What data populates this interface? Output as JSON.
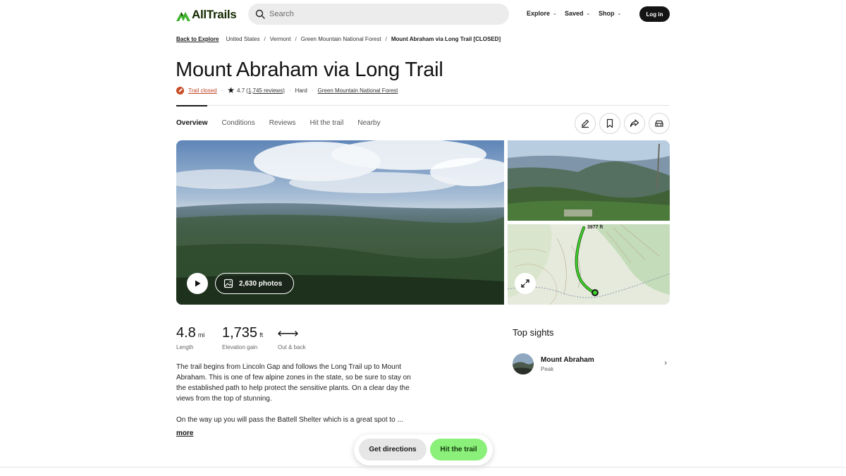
{
  "brand": {
    "name": "AllTrails",
    "accent": "#8bf07a"
  },
  "search": {
    "placeholder": "Search"
  },
  "nav": {
    "explore": "Explore",
    "saved": "Saved",
    "shop": "Shop",
    "login": "Log in"
  },
  "breadcrumb": {
    "back": "Back to Explore",
    "items": [
      "United States",
      "Vermont",
      "Green Mountain National Forest"
    ],
    "current": "Mount Abraham via Long Trail [CLOSED]"
  },
  "trail": {
    "title": "Mount Abraham via Long Trail",
    "status": "Trail closed",
    "rating": "4.7",
    "reviews": "(1,745 reviews)",
    "difficulty": "Hard",
    "forest": "Green Mountain National Forest"
  },
  "tabs": [
    "Overview",
    "Conditions",
    "Reviews",
    "Hit the trail",
    "Nearby"
  ],
  "actions": [
    "edit-icon",
    "bookmark-icon",
    "share-icon",
    "car-icon"
  ],
  "photos": {
    "count_label": "2,630 photos",
    "map_elevation": "3977 ft"
  },
  "stats": {
    "length": {
      "value": "4.8",
      "unit": "mi",
      "label": "Length"
    },
    "elevation": {
      "value": "1,735",
      "unit": "ft",
      "label": "Elevation gain"
    },
    "route": {
      "label": "Out & back"
    }
  },
  "description": {
    "p1": "The trail begins from Lincoln Gap and follows the Long Trail up to Mount Abraham. This is one of few alpine zones in the state, so be sure to stay on the established path to help protect the sensitive plants. On a clear day the views from the top of stunning.",
    "p2": "On the way up you will pass the Battell Shelter which is a great spot to ...",
    "more": "more"
  },
  "sights": {
    "title": "Top sights",
    "items": [
      {
        "name": "Mount Abraham",
        "type": "Peak"
      }
    ]
  },
  "cta": {
    "directions": "Get directions",
    "hit": "Hit the trail"
  }
}
